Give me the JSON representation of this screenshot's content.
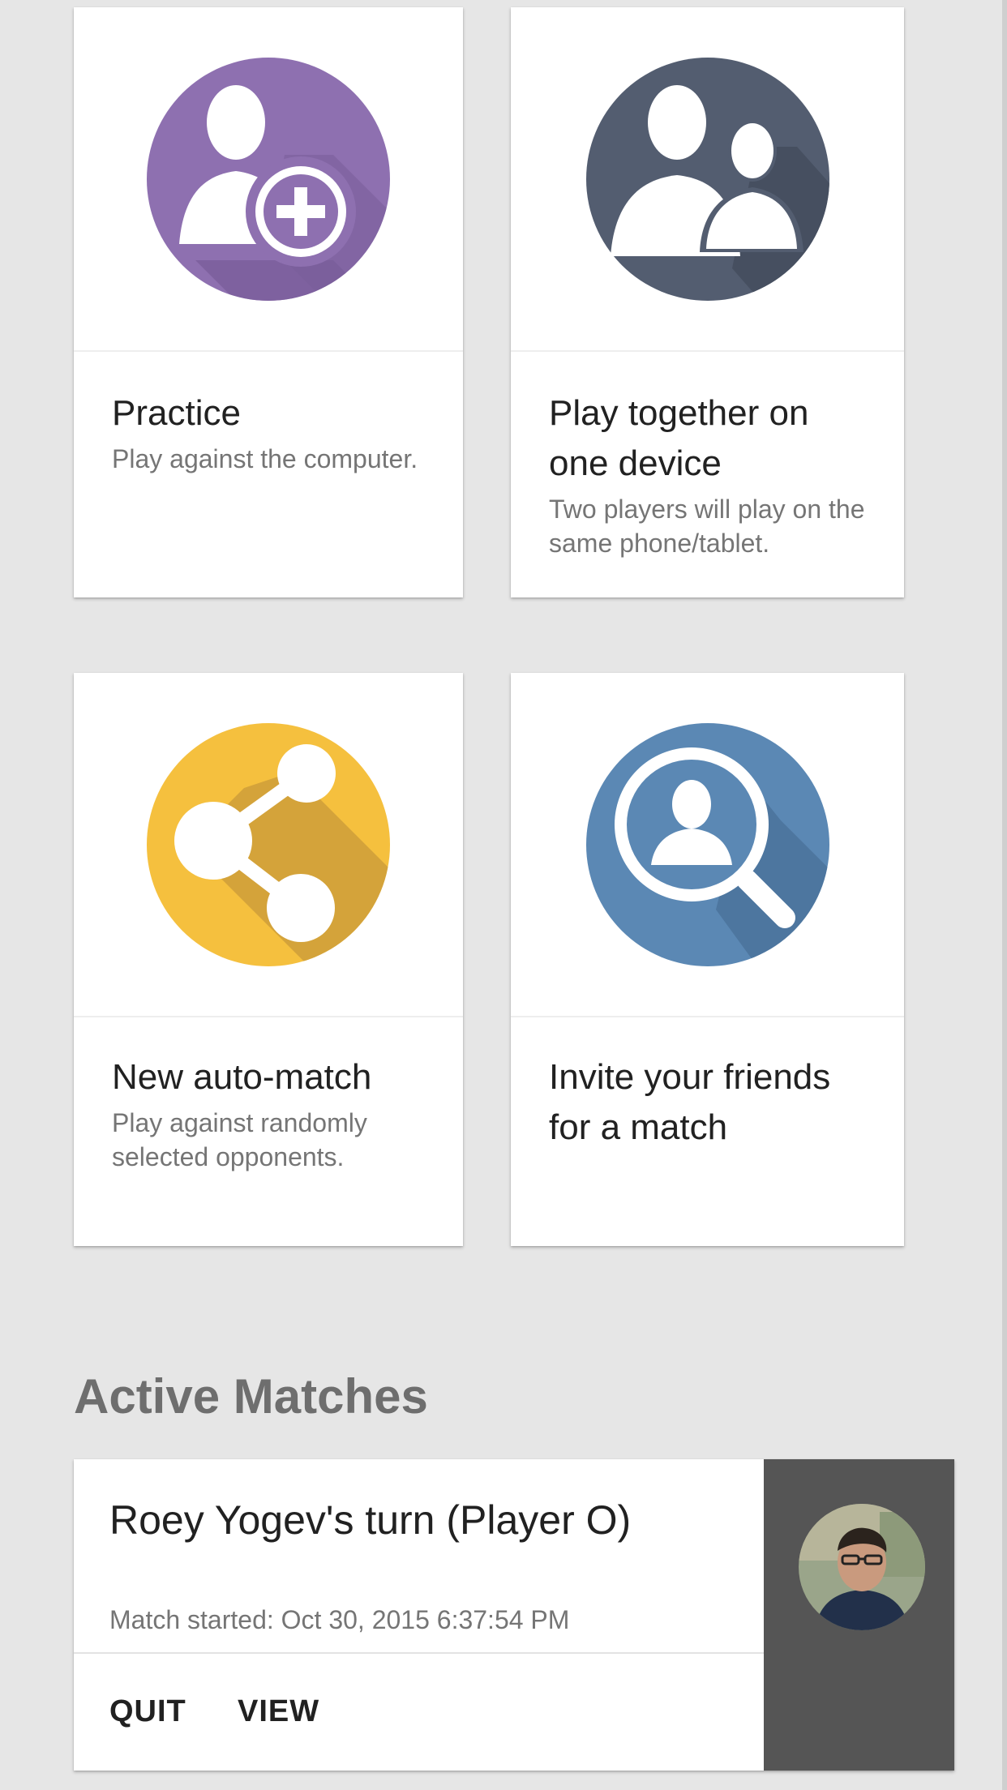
{
  "game_cards": [
    {
      "title": "Practice",
      "description": "Play against the computer.",
      "icon": "add-person-icon",
      "color": "#8e70b0"
    },
    {
      "title": "Play together on one device",
      "description": "Two players will play on the same phone/tablet.",
      "icon": "two-people-icon",
      "color": "#535d70"
    },
    {
      "title": "New auto-match",
      "description": "Play against randomly selected opponents.",
      "icon": "share-icon",
      "color": "#f5c03e"
    },
    {
      "title": "Invite your friends for a match",
      "description": "",
      "icon": "search-person-icon",
      "color": "#5b88b4"
    }
  ],
  "active_matches": {
    "heading": "Active Matches",
    "matches": [
      {
        "title": "Roey Yogev's turn (Player O)",
        "started": "Match started: Oct 30, 2015 6:37:54 PM",
        "quit_label": "QUIT",
        "view_label": "VIEW"
      }
    ]
  }
}
